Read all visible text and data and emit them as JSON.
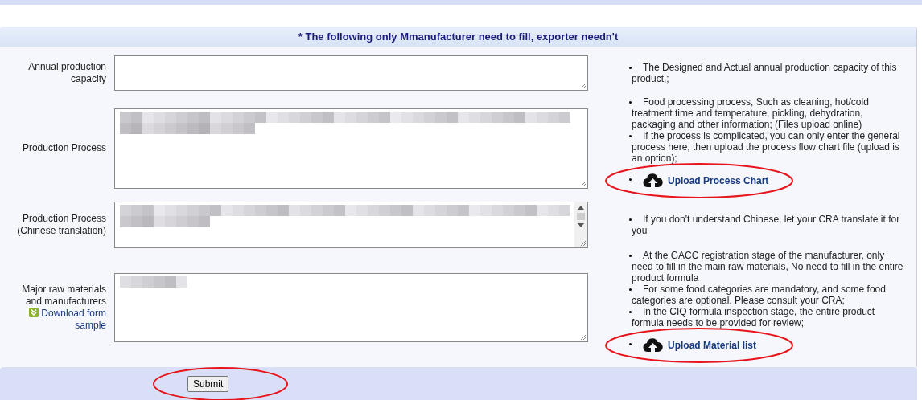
{
  "section_title": "* The following only Mmanufacturer need to fill, exporter needn't",
  "rows": [
    {
      "label": "Annual production capacity",
      "link": null,
      "field": {
        "blurred": false,
        "scrollbar": false
      },
      "notes": [
        {
          "kind": "text",
          "text": "The Designed and Actual annual production capacity of this product,;"
        }
      ]
    },
    {
      "label": "Production Process",
      "link": null,
      "field": {
        "blurred": true,
        "scrollbar": false
      },
      "notes": [
        {
          "kind": "text",
          "text": "Food processing process, Such as cleaning, hot/cold treatment time and temperature, pickling, dehydration, packaging and other information; (Files upload online)"
        },
        {
          "kind": "text",
          "text": "If the process is complicated, you can only enter the general process here, then upload the process flow chart file (upload is an option);"
        },
        {
          "kind": "upload",
          "text": "Upload Process Chart",
          "circled": true
        }
      ]
    },
    {
      "label": "Production Process (Chinese translation)",
      "link": null,
      "field": {
        "blurred": true,
        "scrollbar": true
      },
      "notes": [
        {
          "kind": "text",
          "text": "If you don't understand Chinese, let your CRA translate it for you"
        }
      ]
    },
    {
      "label": "Major raw materials and manufacturers",
      "link": "Download form sample",
      "field": {
        "blurred": true,
        "scrollbar": false
      },
      "notes": [
        {
          "kind": "text",
          "text": "At the GACC registration stage of the manufacturer, only need to fill in the main raw materials, No need to fill in the entire product formula"
        },
        {
          "kind": "text",
          "text": "For some food categories are mandatory, and some food categories are optional. Please consult your CRA;"
        },
        {
          "kind": "text",
          "text": "In the CIQ formula inspection stage, the entire product formula needs to be provided for review;"
        },
        {
          "kind": "upload",
          "text": "Upload Material list",
          "circled": true
        }
      ]
    }
  ],
  "submit": {
    "label": "Submit",
    "circled": true
  }
}
